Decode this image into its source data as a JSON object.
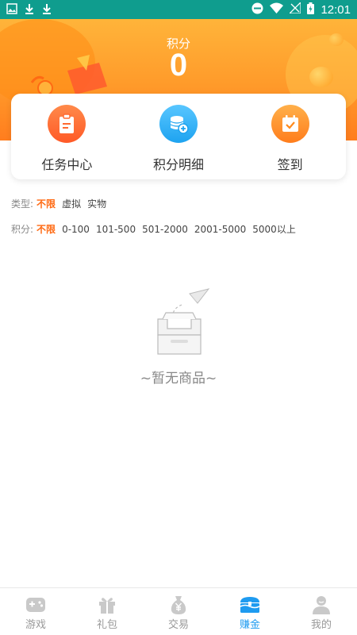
{
  "status_bar": {
    "time": "12:01"
  },
  "header": {
    "points_label": "积分",
    "points_value": "0"
  },
  "card": {
    "items": [
      {
        "label": "任务中心",
        "icon": "clipboard-icon"
      },
      {
        "label": "积分明细",
        "icon": "coins-icon"
      },
      {
        "label": "签到",
        "icon": "calendar-check-icon"
      }
    ]
  },
  "filters": {
    "type": {
      "label": "类型:",
      "options": [
        "不限",
        "虚拟",
        "实物"
      ],
      "active": "不限"
    },
    "points": {
      "label": "积分:",
      "options": [
        "不限",
        "0-100",
        "101-500",
        "501-2000",
        "2001-5000",
        "5000以上"
      ],
      "active": "不限"
    }
  },
  "empty": {
    "text": "~暂无商品~"
  },
  "bottom_nav": {
    "items": [
      {
        "label": "游戏",
        "icon": "gamepad-icon"
      },
      {
        "label": "礼包",
        "icon": "gift-icon"
      },
      {
        "label": "交易",
        "icon": "yen-bag-icon"
      },
      {
        "label": "赚金",
        "icon": "treasure-chest-icon"
      },
      {
        "label": "我的",
        "icon": "user-icon"
      }
    ],
    "active": "赚金"
  },
  "colors": {
    "accent": "#ff6a13",
    "nav_active": "#1e9bf0",
    "status_bar": "#0f9d8e"
  }
}
